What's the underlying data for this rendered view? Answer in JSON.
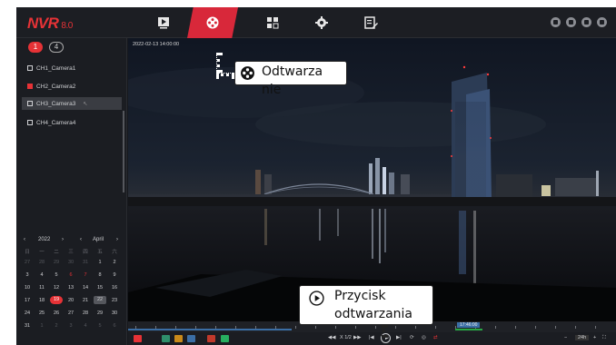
{
  "app": {
    "logo": "NVR",
    "version": "8.0",
    "brand_color": "#e63236",
    "nav": [
      {
        "name": "live-view",
        "icon": "play-square-icon"
      },
      {
        "name": "playback",
        "icon": "film-reel-icon",
        "active": true
      },
      {
        "name": "file-management",
        "icon": "files-icon"
      },
      {
        "name": "settings",
        "icon": "gear-icon"
      },
      {
        "name": "ai-functions",
        "icon": "edit-list-icon"
      }
    ],
    "top_icons": [
      "bell-icon",
      "lock-icon",
      "grid-icon",
      "power-icon"
    ]
  },
  "sidebar": {
    "split_1": "1",
    "split_4": "4",
    "cameras": [
      {
        "label": "CH1_Camera1",
        "checked": false,
        "selected": false
      },
      {
        "label": "CH2_Camera2",
        "checked": true,
        "selected": false
      },
      {
        "label": "CH3_Camera3",
        "checked": false,
        "selected": true
      },
      {
        "label": "CH4_Camera4",
        "checked": false,
        "selected": false
      }
    ]
  },
  "calendar": {
    "year": "2022",
    "month": "April",
    "weekdays": [
      "日",
      "一",
      "二",
      "三",
      "四",
      "五",
      "六"
    ],
    "rows": [
      [
        "27",
        "28",
        "29",
        "30",
        "31",
        "1",
        "2"
      ],
      [
        "3",
        "4",
        "5",
        "6",
        "7",
        "8",
        "9"
      ],
      [
        "10",
        "11",
        "12",
        "13",
        "14",
        "15",
        "16"
      ],
      [
        "17",
        "18",
        "19",
        "20",
        "21",
        "22",
        "23"
      ],
      [
        "24",
        "25",
        "26",
        "27",
        "28",
        "29",
        "30"
      ],
      [
        "31",
        "1",
        "2",
        "3",
        "4",
        "5",
        "6"
      ]
    ],
    "today": "19",
    "selected": "22"
  },
  "video": {
    "timestamp": "2022-02-13 14:00:00"
  },
  "timeline": {
    "cursor_label": "17:46:00",
    "recording_color": "#28a745"
  },
  "controls": {
    "speed": "X 1/2",
    "time_range": "24h"
  },
  "callouts": {
    "playback": "Odtwarza\nnie",
    "play_button": "Przycisk\nodtwarzania"
  }
}
